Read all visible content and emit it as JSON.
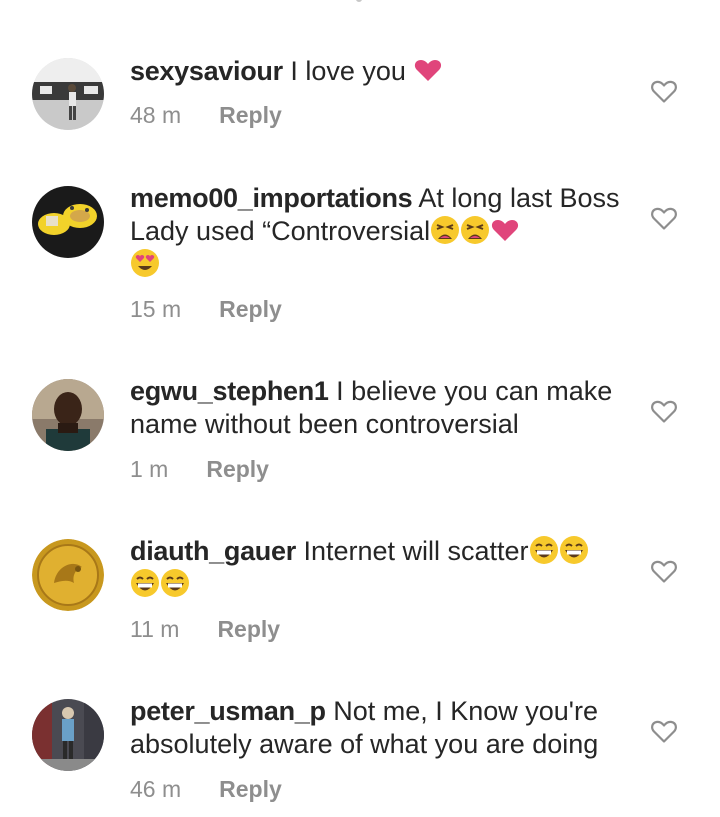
{
  "comments": [
    {
      "username": "sexysaviour",
      "text": " I love you ",
      "emojis": [
        "heart"
      ],
      "time": "48 m",
      "reply_label": "Reply"
    },
    {
      "username": "memo00_importations",
      "text": " At long last Boss Lady used “Controversial",
      "emojis": [
        "tired-face",
        "tired-face",
        "heart",
        "heart-eyes"
      ],
      "time": "15 m",
      "reply_label": "Reply"
    },
    {
      "username": "egwu_stephen1",
      "text": " I believe you can make name without been controversial",
      "emojis": [],
      "time": "1 m",
      "reply_label": "Reply"
    },
    {
      "username": "diauth_gauer",
      "text": " Internet will scatter",
      "emojis": [
        "laughing-face",
        "laughing-face",
        "laughing-face",
        "laughing-face"
      ],
      "time": "11 m",
      "reply_label": "Reply"
    },
    {
      "username": "peter_usman_p",
      "text": " Not me, I Know you're absolutely aware of what you are doing",
      "emojis": [],
      "time": "46 m",
      "reply_label": "Reply"
    }
  ],
  "colors": {
    "text": "#262626",
    "meta": "#8e8e8e",
    "heart": "#e0457b",
    "emoji_yellow": "#f7c92c"
  }
}
